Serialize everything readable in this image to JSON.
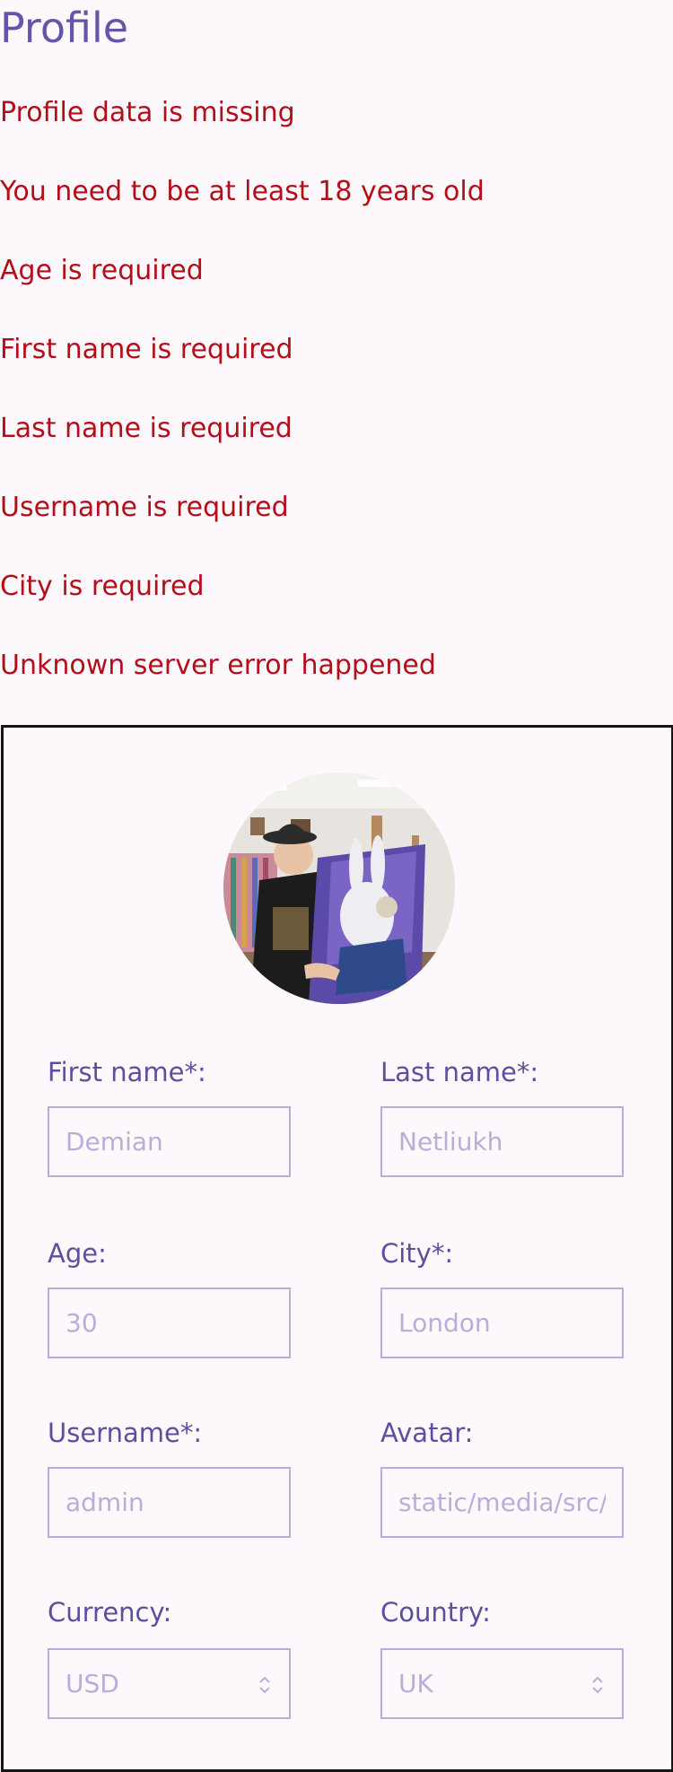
{
  "page_title": "Profile",
  "errors": [
    "Profile data is missing",
    "You need to be at least 18 years old",
    "Age is required",
    "First name is required",
    "Last name is required",
    "Username is required",
    "City is required",
    "Unknown server error happened"
  ],
  "form": {
    "first_name": {
      "label": "First name*:",
      "placeholder": "Demian"
    },
    "last_name": {
      "label": "Last name*:",
      "placeholder": "Netliukh"
    },
    "age": {
      "label": "Age:",
      "placeholder": "30"
    },
    "city": {
      "label": "City*:",
      "placeholder": "London"
    },
    "username": {
      "label": "Username*:",
      "placeholder": "admin"
    },
    "avatar": {
      "label": "Avatar:",
      "placeholder": "static/media/src/"
    },
    "currency": {
      "label": "Currency:",
      "value": "USD"
    },
    "country": {
      "label": "Country:",
      "value": "UK"
    }
  },
  "colors": {
    "title": "#6356a8",
    "error": "#b30f1a",
    "label": "#5c4f9f",
    "field_border": "#b8aed9",
    "background": "#fdf8fb"
  }
}
